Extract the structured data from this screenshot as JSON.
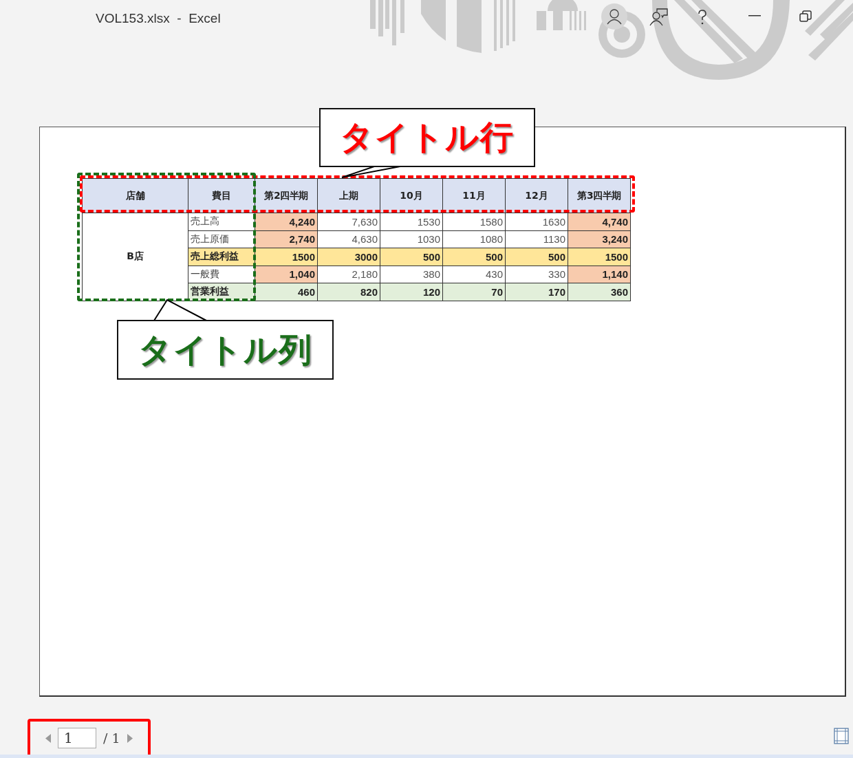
{
  "window": {
    "title": "VOL153.xlsx  -  Excel"
  },
  "table": {
    "columns": [
      {
        "label": "店舗",
        "kind": "heading"
      },
      {
        "label": "費目",
        "kind": "heading"
      },
      {
        "label": "第2四半期",
        "kind": "quarter"
      },
      {
        "label": "上期",
        "kind": "month"
      },
      {
        "label": "10月",
        "kind": "month"
      },
      {
        "label": "11月",
        "kind": "month"
      },
      {
        "label": "12月",
        "kind": "month"
      },
      {
        "label": "第3四半期",
        "kind": "quarter"
      }
    ],
    "store": "B店",
    "rows": [
      {
        "label": "売上高",
        "kind": "normal",
        "values": [
          "4,240",
          "7,630",
          "1530",
          "1580",
          "1630",
          "4,740"
        ]
      },
      {
        "label": "売上原価",
        "kind": "normal",
        "values": [
          "2,740",
          "4,630",
          "1030",
          "1080",
          "1130",
          "3,240"
        ]
      },
      {
        "label": "売上総利益",
        "kind": "subtotal",
        "values": [
          "1500",
          "3000",
          "500",
          "500",
          "500",
          "1500"
        ]
      },
      {
        "label": "一般費",
        "kind": "normal",
        "values": [
          "1,040",
          "2,180",
          "380",
          "430",
          "330",
          "1,140"
        ]
      },
      {
        "label": "営業利益",
        "kind": "total",
        "values": [
          "460",
          "820",
          "120",
          "70",
          "170",
          "360"
        ]
      }
    ]
  },
  "callouts": [
    {
      "text": "タイトル行",
      "color": "#ff0000",
      "kind": "row"
    },
    {
      "text": "タイトル列",
      "color": "#1a6e1a",
      "kind": "column"
    }
  ],
  "page_nav": {
    "current": "1",
    "total": "/ 1"
  }
}
